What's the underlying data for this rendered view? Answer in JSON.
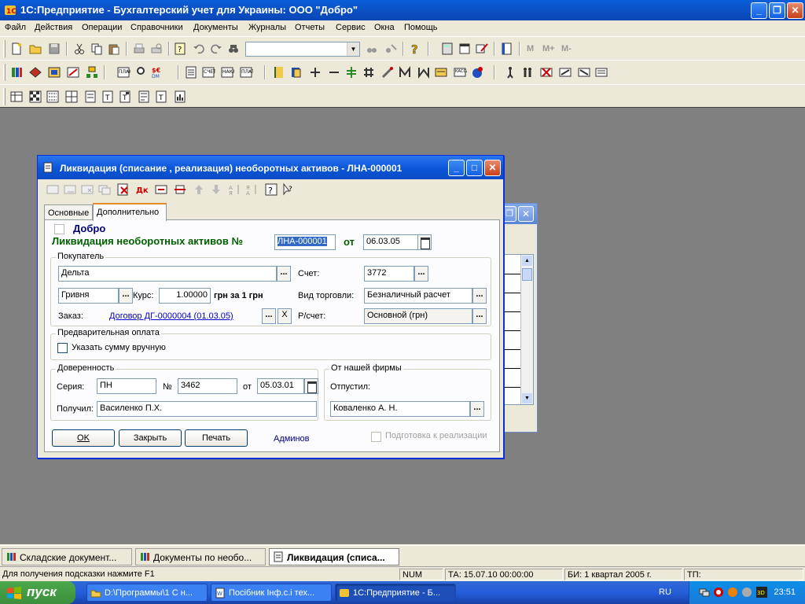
{
  "app": {
    "title": "1С:Предприятие - Бухгалтерский учет для Украины: ООО \"Добро\""
  },
  "menu": [
    "Файл",
    "Действия",
    "Операции",
    "Справочники",
    "Документы",
    "Журналы",
    "Отчеты",
    "Сервис",
    "Окна",
    "Помощь"
  ],
  "toolbar": {
    "calc_labels": [
      "M",
      "M+",
      "M-"
    ]
  },
  "dialog": {
    "title": "Ликвидация (списание , реализация) необоротных активов - ЛНА-000001",
    "tabs": [
      "Основные",
      "Дополнительно"
    ],
    "company": "Добро",
    "doc_heading": "Ликвидация необоротных активов №",
    "doc_number": "ЛНА-000001",
    "from_label": "от",
    "doc_date": "06.03.05",
    "buyer_group": "Покупатель",
    "buyer": "Дельта",
    "account_label": "Счет:",
    "account": "3772",
    "currency": "Гривня",
    "rate_label": "Курс:",
    "rate": "1.00000",
    "rate_unit": "грн за 1 грн",
    "trade_type_label": "Вид торговли:",
    "trade_type": "Безналичный расчет",
    "order_label": "Заказ:",
    "order_link": "Договор ДГ-0000004 (01.03.05)",
    "bank_account_label": "Р/счет:",
    "bank_account": "Основной (грн)",
    "prepay_group": "Предварительная оплата",
    "prepay_check": "Указать сумму вручную",
    "proxy_group": "Доверенность",
    "series_label": "Серия:",
    "series": "ПН",
    "number_label": "№",
    "number": "3462",
    "proxy_from_label": "от",
    "proxy_date": "05.03.01",
    "received_label": "Получил:",
    "received": "Василенко П.Х.",
    "firm_group": "От нашей фирмы",
    "released_label": "Отпустил:",
    "released": "Коваленко А. Н.",
    "ok": "OK",
    "close": "Закрыть",
    "print": "Печать",
    "admin": "Админов",
    "prepare_check": "Подготовка к реализации"
  },
  "window_tabs": [
    {
      "label": "Складские документ..."
    },
    {
      "label": "Документы по необо..."
    },
    {
      "label": "Ликвидация (списа..."
    }
  ],
  "status": {
    "hint": "Для получения подсказки нажмите F1",
    "num": "NUM",
    "ta": "ТА: 15.07.10  00:00:00",
    "bi": "БИ: 1 квартал 2005 г.",
    "tp": "ТП:"
  },
  "taskbar": {
    "start": "пуск",
    "buttons": [
      {
        "label": "D:\\Программы\\1 С н..."
      },
      {
        "label": "Посібник Інф.с.і тех..."
      },
      {
        "label": "1С:Предприятие - Б..."
      }
    ],
    "lang": "RU",
    "time": "23:51"
  }
}
